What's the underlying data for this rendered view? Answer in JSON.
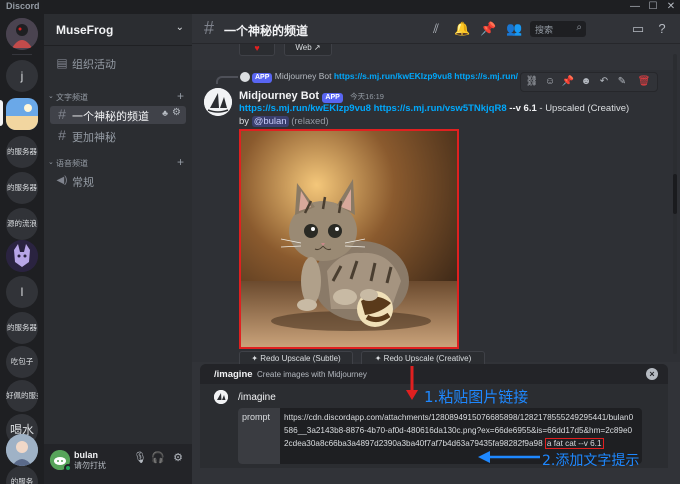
{
  "window": {
    "title": "Discord"
  },
  "rail": {
    "servers": [
      {
        "label": "j"
      },
      {
        "label": "的服务器"
      },
      {
        "label": "的服务器"
      },
      {
        "label": "源的流浪"
      },
      {
        "label": "l"
      },
      {
        "label": "的服务器"
      },
      {
        "label": "吃包子"
      },
      {
        "label": "好佩的服务"
      },
      {
        "label": "喝水"
      },
      {
        "label": "的服务"
      }
    ]
  },
  "sidebar": {
    "guild_name": "MuseFrog",
    "activities": "组织活动",
    "text_category": "文字频道",
    "channels": [
      {
        "name": "一个神秘的频道"
      },
      {
        "name": "更加神秘"
      }
    ],
    "voice_category": "语音频道",
    "voice_channels": [
      {
        "name": "常规"
      }
    ]
  },
  "user": {
    "name": "bulan",
    "status": "请勿打扰"
  },
  "topbar": {
    "channel_name": "一个神秘的频道",
    "search_placeholder": "搜索"
  },
  "prev_message": {
    "web_label": "Web"
  },
  "message": {
    "reply_author": "Midjourney Bot",
    "reply_link": "https://s.mj.run/kwEKIzp9vu8 https://s.mj.run/",
    "app_tag": "APP",
    "author": "Midjourney Bot",
    "timestamp": "今天16:19",
    "link1": "https://s.mj.run/kwEKIzp9vu8",
    "link2": "https://s.mj.run/vsw5TNkjqR8",
    "suffix": "--v 6.1",
    "upscale_note": " - Upscaled (Creative)",
    "by_label": "by ",
    "mention": "@bulan",
    "relaxed": " (relaxed)",
    "buttons": [
      {
        "label": "Redo Upscale (Subtle)"
      },
      {
        "label": "Redo Upscale (Creative)"
      }
    ]
  },
  "command_panel": {
    "command": "/imagine",
    "description": "Create images with Midjourney",
    "sub_command": "/imagine",
    "prompt_label": "prompt",
    "prompt_text": "https://cdn.discordapp.com/attachments/1280894915076685898/1282178555249295441/bulan0586__3a2143b8-8876-4b70-af0d-480616da130c.png?ex=66de6955&is=66dd17d5&hm=2c89e02cdea30a8c66ba3a4897d2390a3ba40f7af7b4d63a79435fa98282f9a98",
    "keyword": "a fat cat --v 6.1"
  },
  "annotations": {
    "step1": "1.粘贴图片链接",
    "step2": "2.添加文字提示",
    "color": "#1e88ff"
  },
  "colors": {
    "accent": "#5865f2",
    "link": "#00a8fc",
    "highlight_box": "#e02020"
  }
}
